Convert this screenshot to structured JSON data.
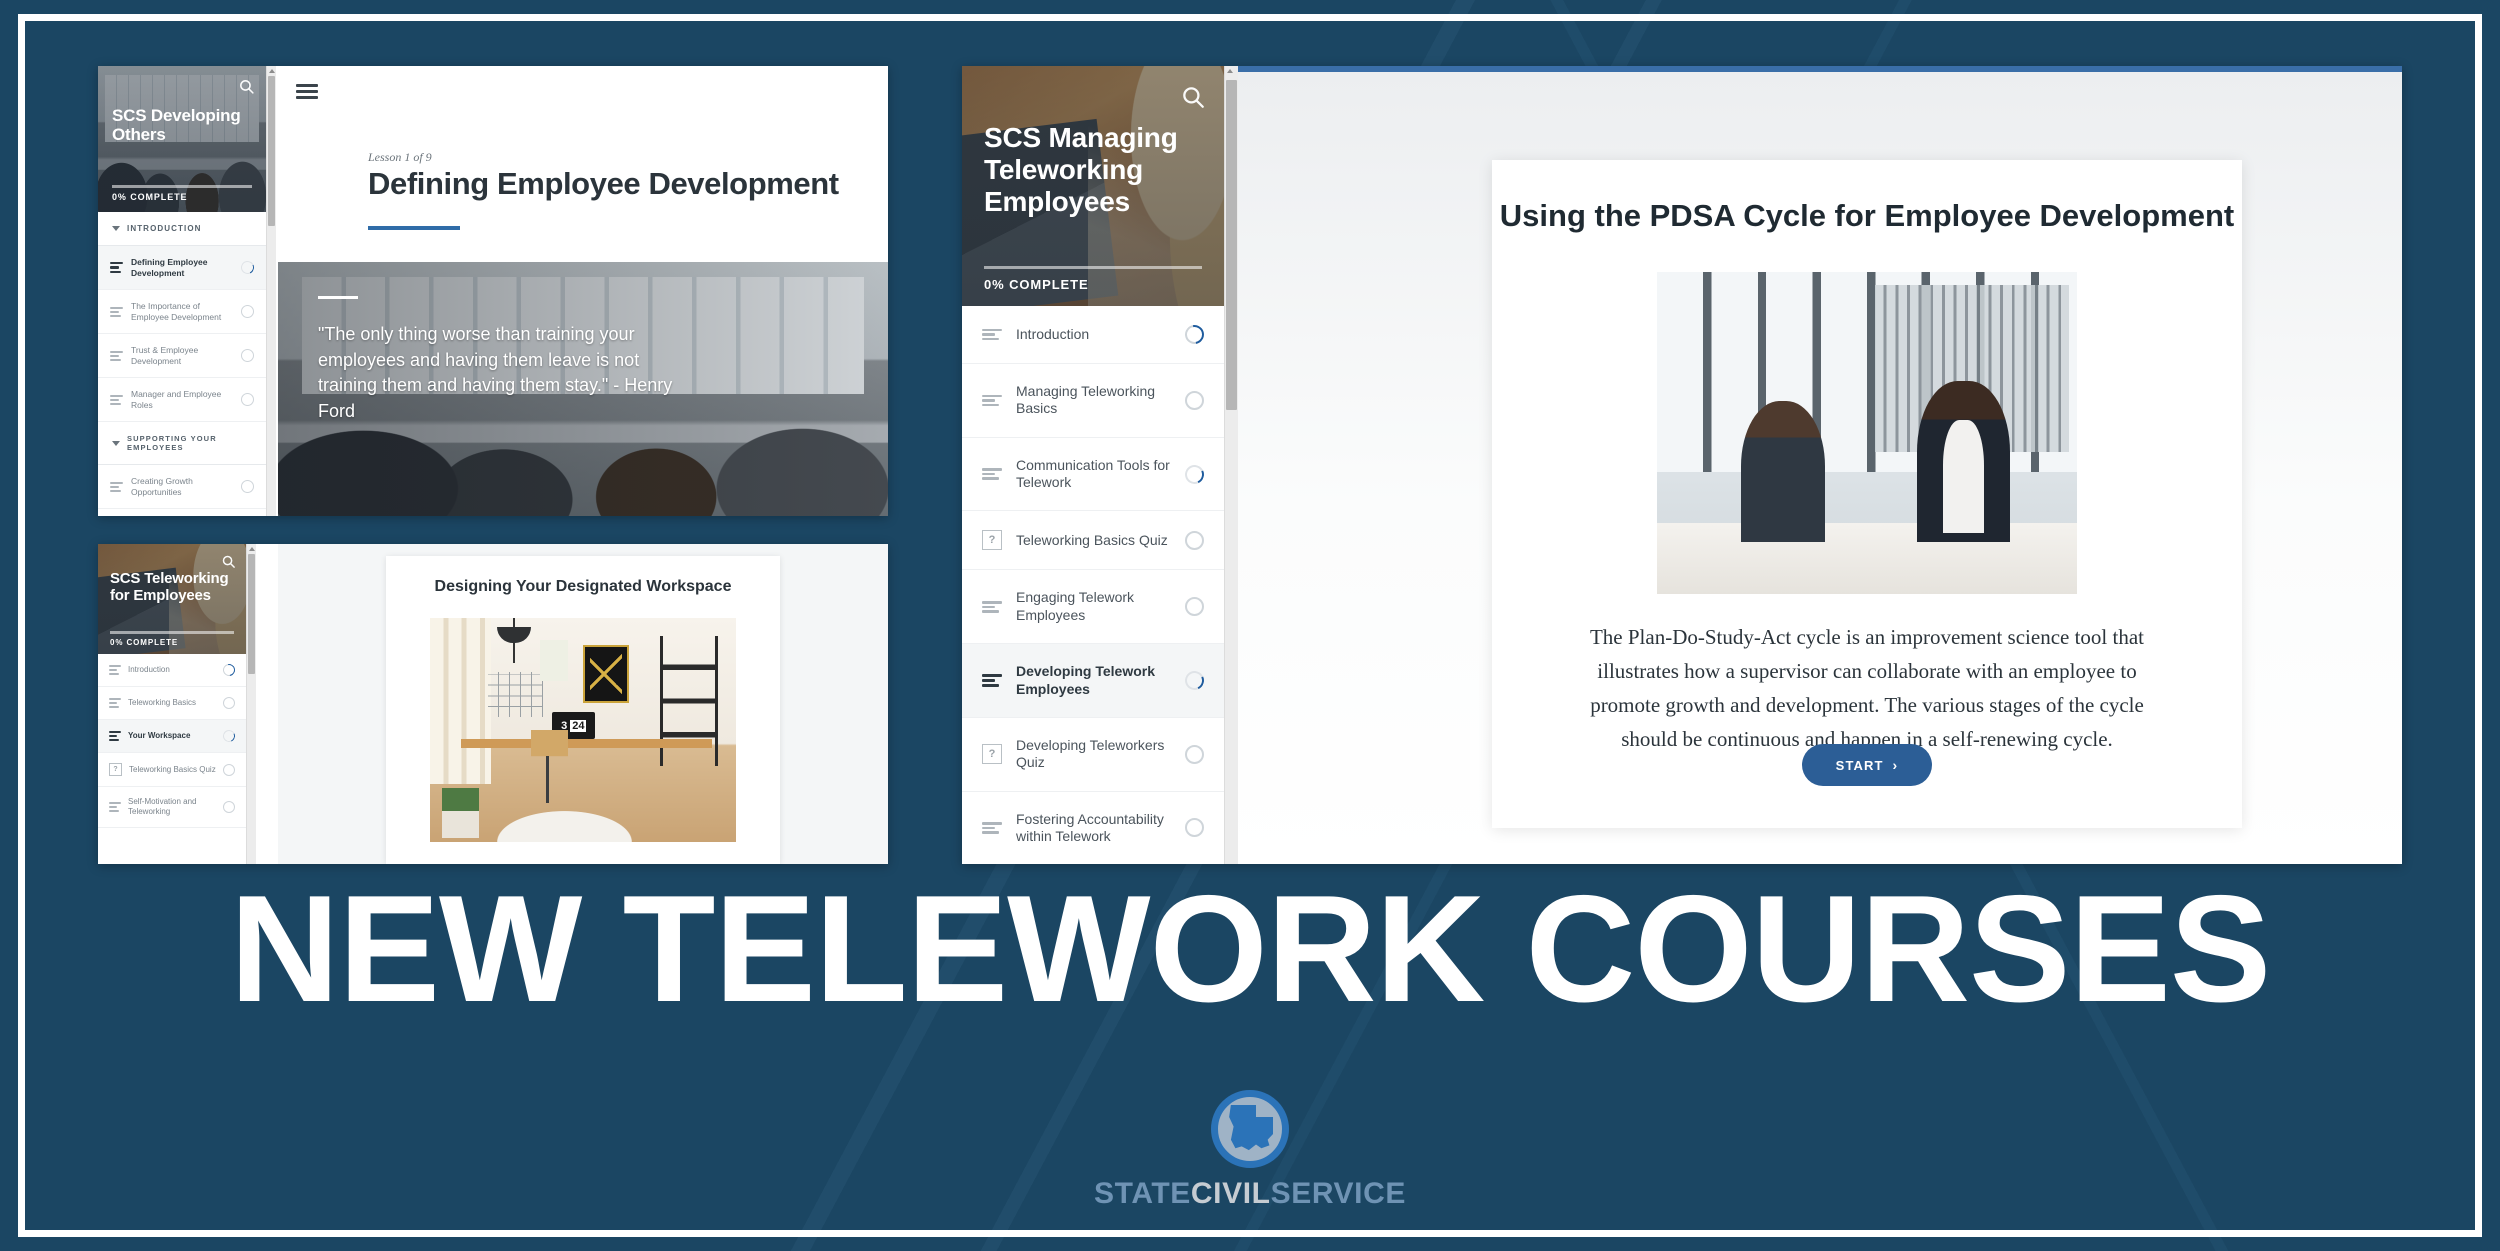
{
  "banner": {
    "headline": "NEW TELEWORK COURSES",
    "background_color": "#1b4663",
    "border_color": "#ffffff",
    "logo": {
      "icon": "louisiana-state-outline-icon",
      "word1": "STATE",
      "word2": "CIVIL",
      "word3": "SERVICE"
    }
  },
  "panels": {
    "developing_others": {
      "sidebar": {
        "search_icon": "search-icon",
        "course_title": "SCS Developing Others",
        "progress_label": "0% COMPLETE",
        "progress_percent": 0,
        "sections": [
          {
            "label": "INTRODUCTION",
            "items": [
              {
                "label": "Defining Employee Development",
                "icon": "lesson-icon",
                "state": "active",
                "status": "partial"
              },
              {
                "label": "The Importance of Employee Development",
                "icon": "lesson-icon",
                "state": "idle",
                "status": "empty"
              },
              {
                "label": "Trust & Employee Development",
                "icon": "lesson-icon",
                "state": "idle",
                "status": "empty"
              },
              {
                "label": "Manager and Employee Roles",
                "icon": "lesson-icon",
                "state": "idle",
                "status": "empty"
              }
            ]
          },
          {
            "label": "SUPPORTING YOUR EMPLOYEES",
            "items": [
              {
                "label": "Creating Growth Opportunities",
                "icon": "lesson-icon",
                "state": "idle",
                "status": "empty"
              }
            ]
          }
        ]
      },
      "main": {
        "menu_icon": "hamburger-menu-icon",
        "kicker": "Lesson 1 of 9",
        "title": "Defining Employee Development",
        "quote": "\"The only thing worse than training your employees and having them leave is not training them and having them stay.\" - Henry Ford"
      }
    },
    "teleworking_employees": {
      "sidebar": {
        "search_icon": "search-icon",
        "course_title": "SCS Teleworking for Employees",
        "progress_label": "0% COMPLETE",
        "progress_percent": 0,
        "items": [
          {
            "label": "Introduction",
            "icon": "lesson-icon",
            "state": "idle",
            "status": "partial"
          },
          {
            "label": "Teleworking Basics",
            "icon": "lesson-icon",
            "state": "idle",
            "status": "empty"
          },
          {
            "label": "Your Workspace",
            "icon": "lesson-icon",
            "state": "active",
            "status": "partial"
          },
          {
            "label": "Teleworking Basics Quiz",
            "icon": "quiz-icon",
            "state": "idle",
            "status": "empty"
          },
          {
            "label": "Self-Motivation and Teleworking",
            "icon": "lesson-icon",
            "state": "idle",
            "status": "empty"
          }
        ]
      },
      "main": {
        "title": "Designing Your Designated Workspace",
        "image_alt": "home-office-workspace-photo"
      }
    },
    "managing_teleworking": {
      "sidebar": {
        "search_icon": "search-icon",
        "course_title": "SCS Managing Teleworking Employees",
        "progress_label": "0% COMPLETE",
        "progress_percent": 0,
        "items": [
          {
            "label": "Introduction",
            "icon": "lesson-icon",
            "state": "idle",
            "status": "partial"
          },
          {
            "label": "Managing Teleworking Basics",
            "icon": "lesson-icon",
            "state": "idle",
            "status": "empty"
          },
          {
            "label": "Communication Tools for Telework",
            "icon": "lesson-icon",
            "state": "idle",
            "status": "partial"
          },
          {
            "label": "Teleworking Basics Quiz",
            "icon": "quiz-icon",
            "state": "idle",
            "status": "empty"
          },
          {
            "label": "Engaging Telework Employees",
            "icon": "lesson-icon",
            "state": "idle",
            "status": "empty"
          },
          {
            "label": "Developing Telework Employees",
            "icon": "lesson-icon",
            "state": "active",
            "status": "partial"
          },
          {
            "label": "Developing Teleworkers Quiz",
            "icon": "quiz-icon",
            "state": "idle",
            "status": "empty"
          },
          {
            "label": "Fostering Accountability within Telework",
            "icon": "lesson-icon",
            "state": "idle",
            "status": "empty"
          }
        ]
      },
      "main": {
        "title": "Using the PDSA Cycle for Employee Development",
        "image_alt": "two-colleagues-meeting-photo",
        "body": "The Plan-Do-Study-Act cycle is an improvement science tool that illustrates how a supervisor can collaborate with an employee to promote growth and development. The various stages of the cycle should be continuous and happen in a self-renewing cycle.",
        "start_button": "START",
        "start_button_icon": "chevron-right-icon"
      }
    }
  }
}
